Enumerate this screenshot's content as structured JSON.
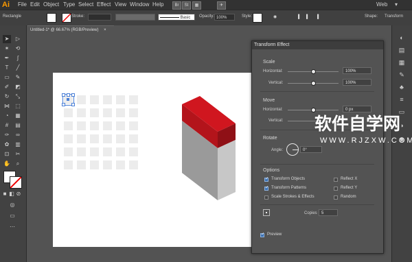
{
  "app": {
    "logo": "Ai"
  },
  "menubar": {
    "items": [
      "File",
      "Edit",
      "Object",
      "Type",
      "Select",
      "Effect",
      "View",
      "Window",
      "Help"
    ],
    "badges": [
      "Br",
      "St"
    ],
    "workspace": "Web"
  },
  "controlbar": {
    "object_type": "Rectangle",
    "stroke_label": "Stroke:",
    "brush_label": "Basic",
    "opacity_label": "Opacity:",
    "opacity_value": "100%",
    "style_label": "Style:",
    "shape_label": "Shape:",
    "transform_label": "Transform"
  },
  "document": {
    "tab_title": "Untitled-1* @ 66.67% (RGB/Preview)"
  },
  "panel": {
    "title": "Transform Effect",
    "scale": {
      "heading": "Scale",
      "horizontal_label": "Horizontal:",
      "horizontal_value": "100%",
      "vertical_label": "Vertical:",
      "vertical_value": "100%"
    },
    "move": {
      "heading": "Move",
      "horizontal_label": "Horizontal:",
      "horizontal_value": "0 px",
      "vertical_label": "Vertical:"
    },
    "rotate": {
      "heading": "Rotate",
      "angle_label": "Angle:",
      "angle_value": "0°"
    },
    "options": {
      "heading": "Options",
      "transform_objects": "Transform Objects",
      "transform_patterns": "Transform Patterns",
      "scale_strokes": "Scale Strokes & Effects",
      "reflect_x": "Reflect X",
      "reflect_y": "Reflect Y",
      "random": "Random"
    },
    "copies_label": "Copies",
    "copies_value": "5",
    "preview_label": "Preview"
  },
  "watermark": {
    "line1": "软件自学网",
    "line2": "WWW.RJZXW.COM"
  },
  "colors": {
    "accent_red": "#d0161f",
    "block_gray": "#9a9a9a"
  }
}
